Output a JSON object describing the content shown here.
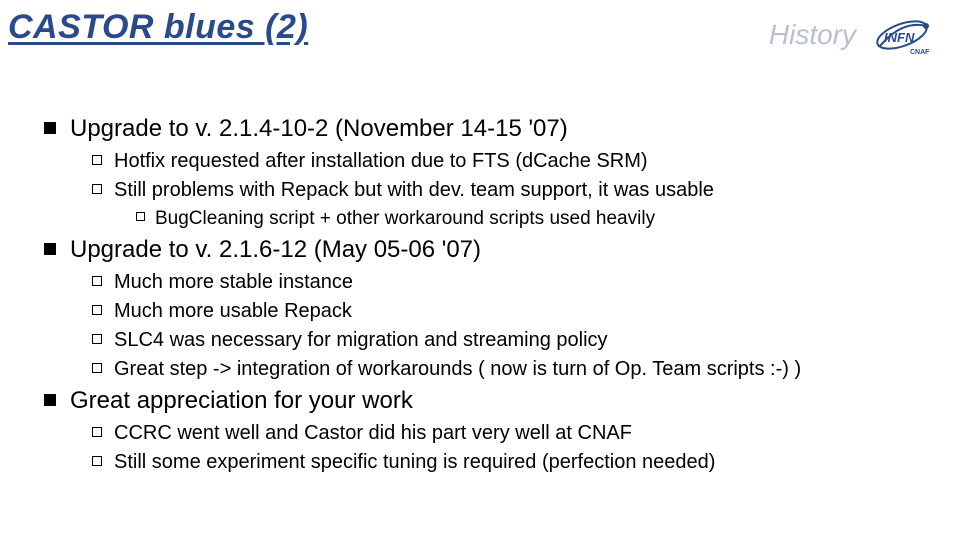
{
  "header": {
    "title": "CASTOR blues (2)",
    "history_label": "History",
    "logo_text": "INFN",
    "logo_sub": "CNAF"
  },
  "content": {
    "item1": {
      "text": "Upgrade to v. 2.1.4-10-2 (November 14-15 '07)",
      "sub": {
        "a": "Hotfix requested after installation due to FTS (dCache SRM)",
        "b": "Still problems with Repack but with dev. team support, it was usable",
        "c": "BugCleaning script + other workaround scripts used heavily"
      }
    },
    "item2": {
      "text": "Upgrade to v. 2.1.6-12 (May 05-06 '07)",
      "sub": {
        "a": "Much more stable instance",
        "b": "Much more usable Repack",
        "c": "SLC4 was necessary for migration and streaming policy",
        "d": "Great step -> integration of workarounds ( now is turn of Op. Team scripts :-) )"
      }
    },
    "item3": {
      "text": "Great appreciation for your work",
      "sub": {
        "a": "CCRC went well and Castor did his part very well at CNAF",
        "b": "Still some experiment specific tuning is required (perfection needed)"
      }
    }
  }
}
